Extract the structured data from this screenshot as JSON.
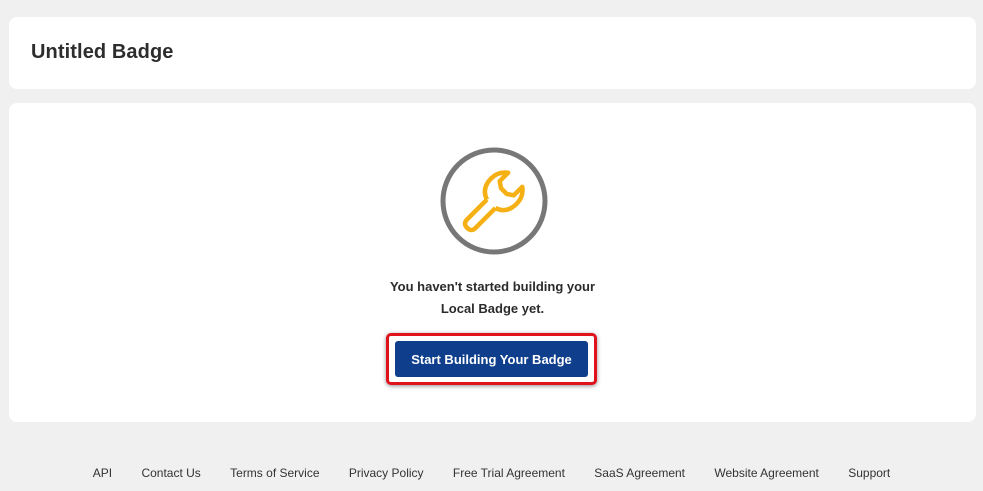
{
  "header": {
    "title": "Untitled Badge"
  },
  "empty_state": {
    "icon": "wrench-icon",
    "line1": "You haven't started building your",
    "line2": "Local Badge yet.",
    "button_label": "Start Building Your Badge"
  },
  "footer": {
    "links": [
      "API",
      "Contact Us",
      "Terms of Service",
      "Privacy Policy",
      "Free Trial Agreement",
      "SaaS Agreement",
      "Website Agreement",
      "Support"
    ]
  },
  "colors": {
    "button": "#0f3f8c",
    "wrench": "#f5b014",
    "circle": "#777777",
    "highlight": "#e0121b"
  }
}
